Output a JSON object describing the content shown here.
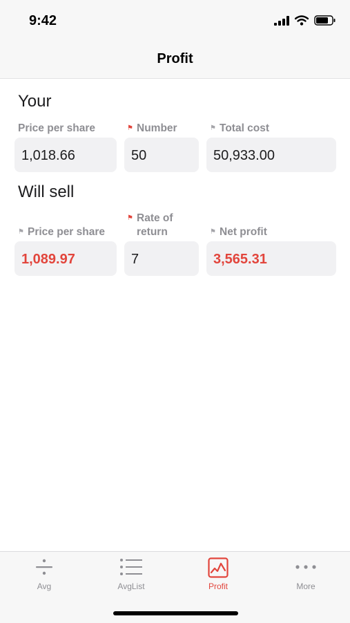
{
  "status_bar": {
    "time": "9:42"
  },
  "nav": {
    "title": "Profit"
  },
  "your": {
    "title": "Your",
    "price_label": "Price per share",
    "price_value": "1,018.66",
    "number_label": "Number",
    "number_value": "50",
    "total_label": "Total cost",
    "total_value": "50,933.00"
  },
  "will_sell": {
    "title": "Will sell",
    "price_label": "Price per share",
    "price_value": "1,089.97",
    "rate_label_line1": "Rate of",
    "rate_label_line2": "return",
    "rate_value": "7",
    "profit_label": "Net profit",
    "profit_value": "3,565.31"
  },
  "tabs": [
    {
      "label": "Avg",
      "icon": "divide-icon"
    },
    {
      "label": "AvgList",
      "icon": "list-icon"
    },
    {
      "label": "Profit",
      "icon": "chart-icon"
    },
    {
      "label": "More",
      "icon": "more-icon"
    }
  ],
  "colors": {
    "accent": "#e2453c",
    "label_grey": "#8e8e93",
    "field_bg": "#f1f1f3"
  }
}
